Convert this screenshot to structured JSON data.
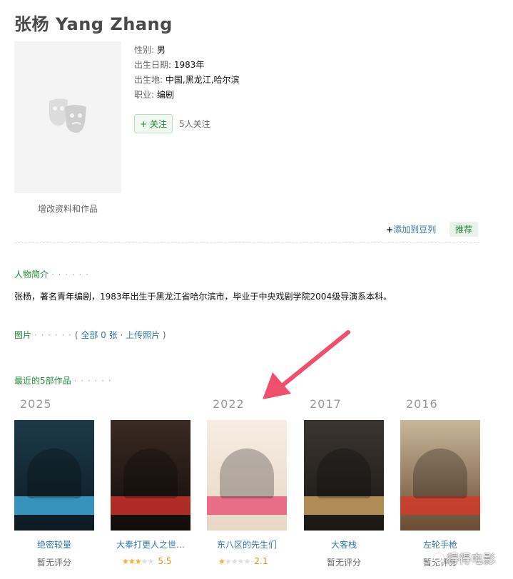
{
  "header": {
    "title": "张杨 Yang Zhang"
  },
  "profile": {
    "edit_link": "增改资料和作品",
    "gender_label": "性别:",
    "gender": "男",
    "birth_label": "出生日期:",
    "birth": "1983年",
    "place_label": "出生地:",
    "place": "中国,黑龙江,哈尔滨",
    "job_label": "职业:",
    "job": "编剧",
    "follow_label": "+ 关注",
    "follow_count": "5人关注",
    "add_doulist": "添加到豆列",
    "recommend": "推荐"
  },
  "bio": {
    "title": "人物简介",
    "dots": "· · · · · ·",
    "text": "张杨，著名青年编剧，1983年出生于黑龙江省哈尔滨市，毕业于中央戏剧学院2004级导演系本科。"
  },
  "photos": {
    "title": "图片",
    "dots": "· · · · · ·",
    "open": "(",
    "all": "全部 0 张",
    "sep": "·",
    "upload": "上传照片",
    "close": ")"
  },
  "works": {
    "title": "最近的5部作品",
    "dots": "· · · · · ·",
    "years": [
      "2025",
      "2022",
      "2017",
      "2016"
    ],
    "items": [
      {
        "title": "绝密较量",
        "rating": "暂无评分",
        "colors": [
          "#1d3a4a",
          "#0d1a22"
        ],
        "accent": "#3fa7d6"
      },
      {
        "title": "大奉打更人之世…",
        "stars": 3,
        "score": "5.5",
        "colors": [
          "#3a2a22",
          "#120c0a"
        ],
        "accent": "#c9302c"
      },
      {
        "title": "东八区的先生们",
        "stars": 1,
        "score": "2.1",
        "colors": [
          "#f6ede2",
          "#e8d7c6"
        ],
        "accent": "#e8597a"
      },
      {
        "title": "大客栈",
        "rating": "暂无评分",
        "colors": [
          "#3b3530",
          "#1a1714"
        ],
        "accent": "#c8a060"
      },
      {
        "title": "左轮手枪",
        "rating": "暂无评分",
        "colors": [
          "#c9b79a",
          "#6a4a33"
        ],
        "accent": "#d13a2a"
      }
    ]
  },
  "watermark": {
    "text": "得得电影"
  },
  "colors": {
    "green": "#1e8c3a",
    "link": "#3377aa",
    "arrow": "#f0506e"
  }
}
